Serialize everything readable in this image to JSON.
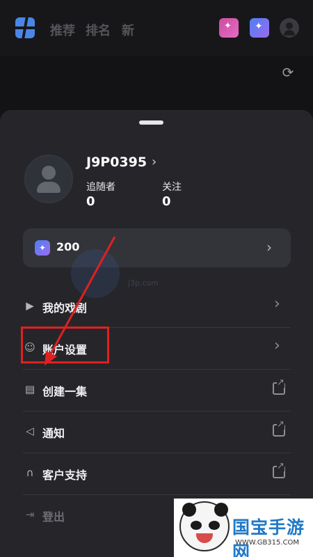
{
  "topbar": {
    "tabs": [
      "推荐",
      "排名",
      "新"
    ],
    "icons": [
      "app-logo-icon",
      "shop-bag-icon",
      "gem-icon",
      "avatar-icon"
    ],
    "refresh_icon": "refresh-icon"
  },
  "profile": {
    "username": "J9P0395",
    "followers_label": "追随者",
    "followers_value": "0",
    "following_label": "关注",
    "following_value": "0"
  },
  "balance": {
    "value": "200"
  },
  "menu": {
    "items": [
      {
        "label": "我的戏剧",
        "icon": "play-icon",
        "trailing": "chevron-right-icon"
      },
      {
        "label": "账户设置",
        "icon": "user-icon",
        "trailing": "chevron-right-icon"
      },
      {
        "label": "创建一集",
        "icon": "create-icon",
        "trailing": "external-link-icon"
      },
      {
        "label": "通知",
        "icon": "megaphone-icon",
        "trailing": "external-link-icon"
      },
      {
        "label": "客户支持",
        "icon": "headset-icon",
        "trailing": "external-link-icon"
      },
      {
        "label": "登出",
        "icon": "logout-icon"
      }
    ]
  },
  "watermark": {
    "url": "j3p.com"
  },
  "badge": {
    "title": "国宝手游网",
    "url": "WWW.GB315.COM"
  },
  "colors": {
    "annotation": "#e02020",
    "sheet": "#26262a",
    "background": "#131316"
  }
}
